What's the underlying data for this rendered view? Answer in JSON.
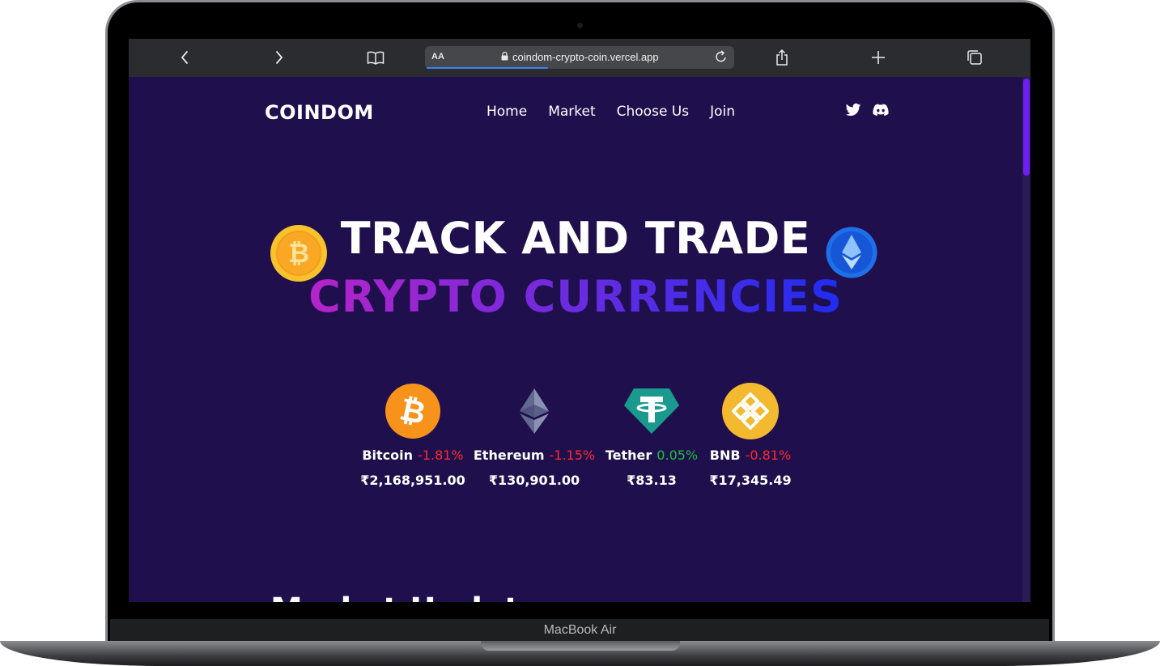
{
  "device": {
    "model_label": "MacBook Air"
  },
  "browser": {
    "text_size_label": "AA",
    "url": "coindom-crypto-coin.vercel.app",
    "icons": [
      "chevron-left-icon",
      "chevron-right-icon",
      "book-icon",
      "lock-icon",
      "reload-icon",
      "share-icon",
      "plus-icon",
      "tabs-icon"
    ]
  },
  "site": {
    "logo": "COINDOM",
    "nav": {
      "home": "Home",
      "market": "Market",
      "choose_us": "Choose Us",
      "join": "Join"
    },
    "social_icons": [
      "twitter-icon",
      "discord-icon"
    ]
  },
  "hero": {
    "line1": "TRACK AND TRADE",
    "line2": "CRYPTO CURRENCIES",
    "gradient_colors": [
      "#b624c9",
      "#6a2be0",
      "#1f2cf0"
    ]
  },
  "coins": [
    {
      "name": "Bitcoin",
      "change": "-1.81%",
      "trend": "negative",
      "price": "₹2,168,951.00",
      "icon": "bitcoin-icon"
    },
    {
      "name": "Ethereum",
      "change": "-1.15%",
      "trend": "negative",
      "price": "₹130,901.00",
      "icon": "ethereum-icon"
    },
    {
      "name": "Tether",
      "change": "0.05%",
      "trend": "positive",
      "price": "₹83.13",
      "icon": "tether-icon"
    },
    {
      "name": "BNB",
      "change": "-0.81%",
      "trend": "negative",
      "price": "₹17,345.49",
      "icon": "bnb-icon"
    }
  ],
  "next_section": {
    "heading_peek": "Market Update"
  },
  "colors": {
    "page_bg": "#200f4d",
    "negative": "#ff2a2a",
    "positive": "#19c23a",
    "scrollbar_thumb": "#6d1ff0"
  }
}
